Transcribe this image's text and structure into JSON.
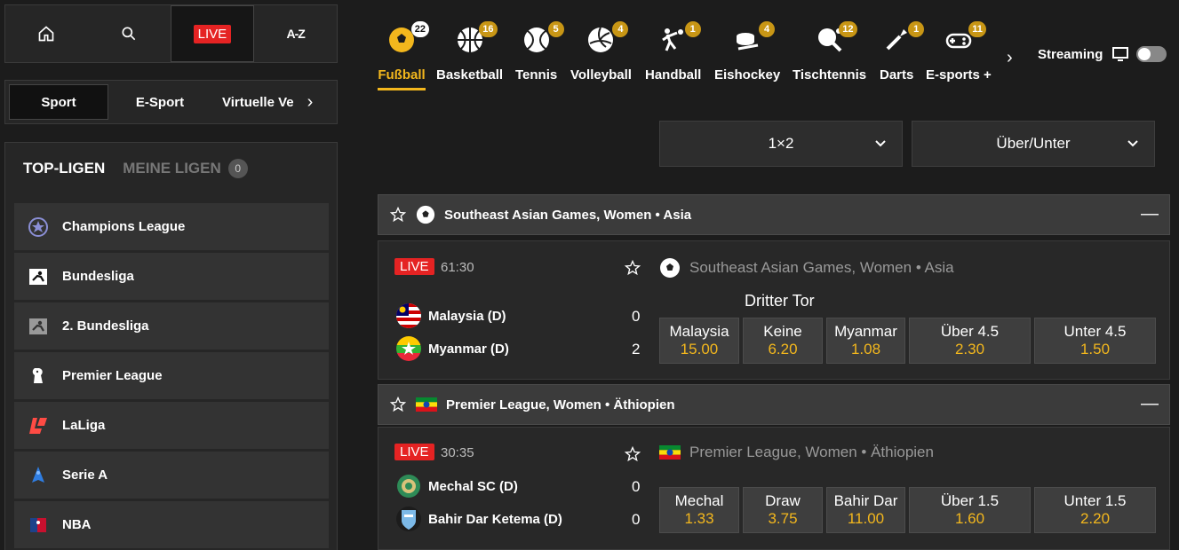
{
  "topnav": {
    "live": "LIVE",
    "az": "A-Z"
  },
  "sport_tabs": {
    "sport": "Sport",
    "esport": "E-Sport",
    "virtual": "Virtuelle Ve"
  },
  "leagues": {
    "top_label": "TOP-LIGEN",
    "mine_label": "MEINE LIGEN",
    "mine_count": "0",
    "items": [
      {
        "name": "Champions League",
        "icon": "champions-league-icon"
      },
      {
        "name": "Bundesliga",
        "icon": "bundesliga-icon"
      },
      {
        "name": "2. Bundesliga",
        "icon": "2-bundesliga-icon"
      },
      {
        "name": "Premier League",
        "icon": "premier-league-icon"
      },
      {
        "name": "LaLiga",
        "icon": "laliga-icon"
      },
      {
        "name": "Serie A",
        "icon": "serie-a-icon"
      },
      {
        "name": "NBA",
        "icon": "nba-icon"
      }
    ]
  },
  "sports": [
    {
      "label": "Fußball",
      "count": "22",
      "active": true
    },
    {
      "label": "Basketball",
      "count": "16"
    },
    {
      "label": "Tennis",
      "count": "5"
    },
    {
      "label": "Volleyball",
      "count": "4"
    },
    {
      "label": "Handball",
      "count": "1"
    },
    {
      "label": "Eishockey",
      "count": "4"
    },
    {
      "label": "Tischtennis",
      "count": "12"
    },
    {
      "label": "Darts",
      "count": "1"
    },
    {
      "label": "E-sports +",
      "count": "11"
    }
  ],
  "streaming": {
    "label": "Streaming"
  },
  "dropdowns": {
    "market1": "1×2",
    "market2": "Über/Unter"
  },
  "colors": {
    "accent": "#f3b71d",
    "live": "#e52323"
  },
  "events": [
    {
      "section": "Southeast Asian Games, Women • Asia",
      "live": "LIVE",
      "time": "61:30",
      "competition": "Southeast Asian Games, Women • Asia",
      "market": "Dritter Tor",
      "home": {
        "name": "Malaysia (D)",
        "score": "0"
      },
      "away": {
        "name": "Myanmar (D)",
        "score": "2"
      },
      "odds": [
        {
          "label": "Malaysia",
          "value": "15.00"
        },
        {
          "label": "Keine",
          "value": "6.20"
        },
        {
          "label": "Myanmar",
          "value": "1.08"
        },
        {
          "label": "Über 4.5",
          "value": "2.30"
        },
        {
          "label": "Unter 4.5",
          "value": "1.50"
        }
      ]
    },
    {
      "section": "Premier League, Women • Äthiopien",
      "live": "LIVE",
      "time": "30:35",
      "competition": "Premier League, Women • Äthiopien",
      "home": {
        "name": "Mechal SC (D)",
        "score": "0"
      },
      "away": {
        "name": "Bahir Dar Ketema (D)",
        "score": "0"
      },
      "odds": [
        {
          "label": "Mechal",
          "value": "1.33"
        },
        {
          "label": "Draw",
          "value": "3.75"
        },
        {
          "label": "Bahir Dar",
          "value": "11.00"
        },
        {
          "label": "Über 1.5",
          "value": "1.60"
        },
        {
          "label": "Unter 1.5",
          "value": "2.20"
        }
      ]
    }
  ]
}
